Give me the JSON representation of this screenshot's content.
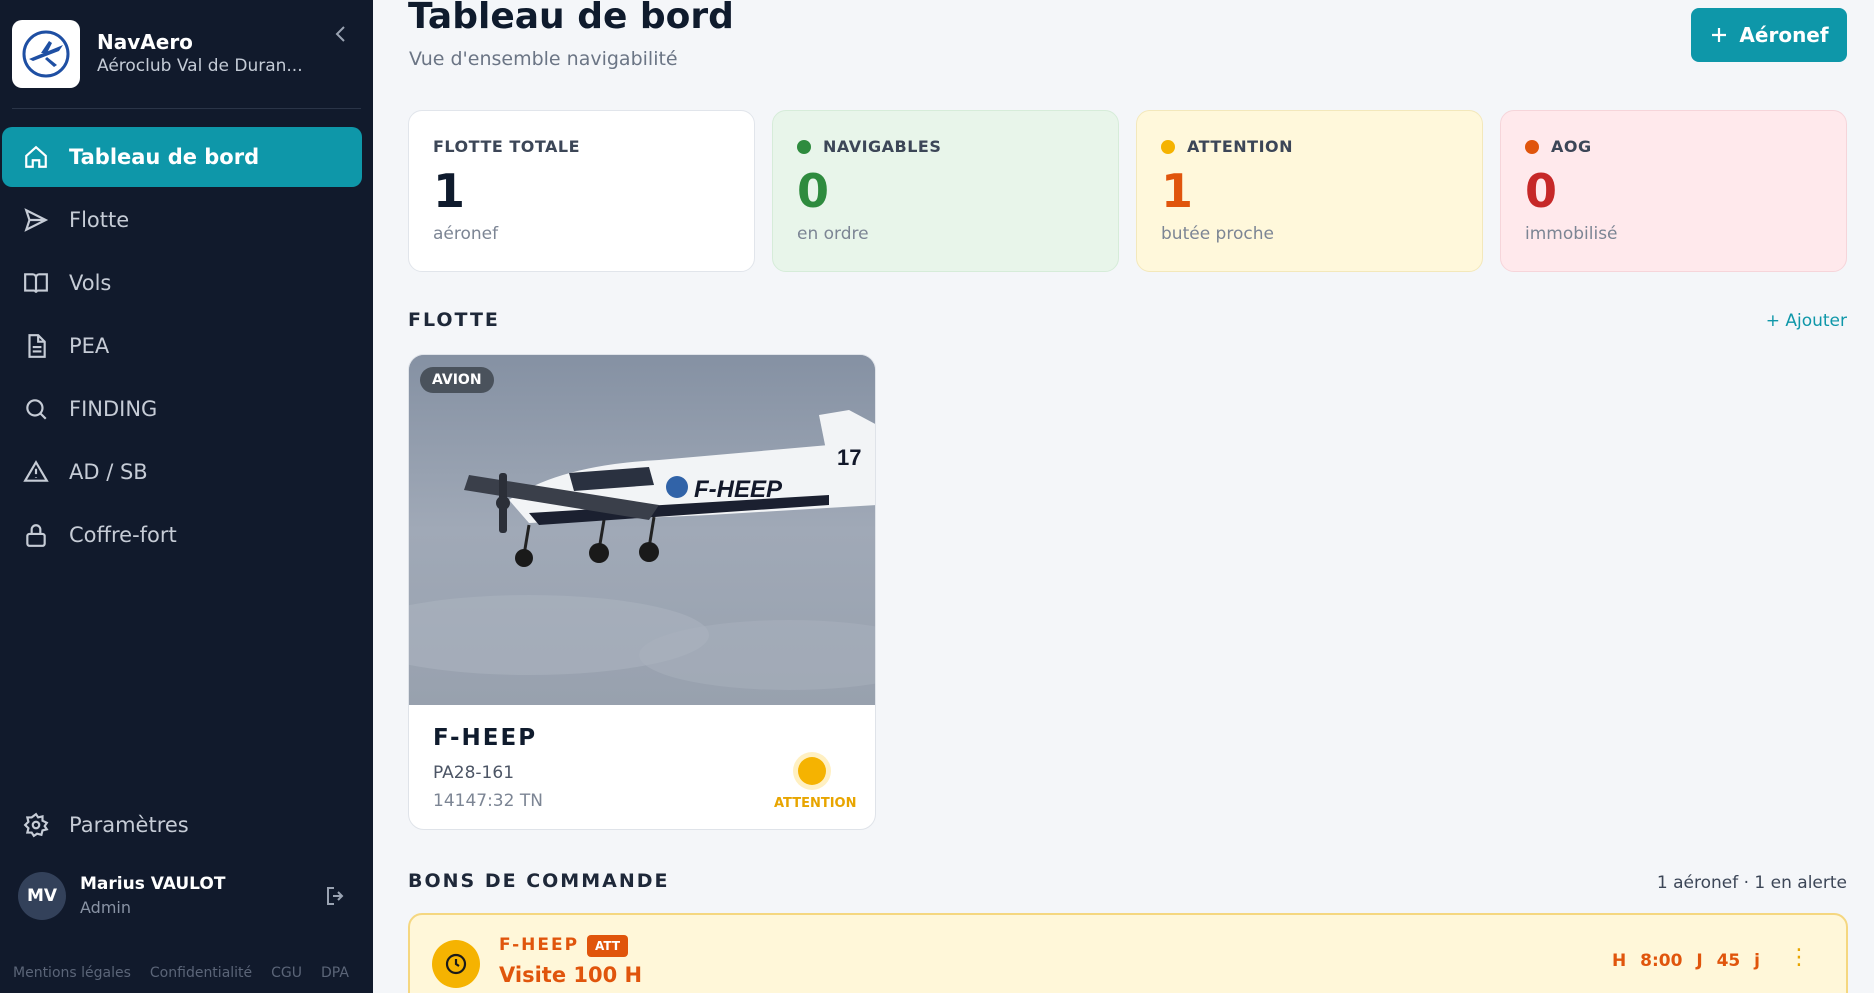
{
  "app": {
    "name": "NavAero",
    "club": "Aéroclub Val de Duran..."
  },
  "nav": [
    {
      "label": "Tableau de bord",
      "icon": "home-icon",
      "active": true
    },
    {
      "label": "Flotte",
      "icon": "send-icon"
    },
    {
      "label": "Vols",
      "icon": "book-icon"
    },
    {
      "label": "PEA",
      "icon": "document-icon"
    },
    {
      "label": "FINDING",
      "icon": "search-icon"
    },
    {
      "label": "AD / SB",
      "icon": "warning-icon"
    },
    {
      "label": "Coffre-fort",
      "icon": "lock-icon"
    }
  ],
  "params_label": "Paramètres",
  "user": {
    "initials": "MV",
    "name": "Marius VAULOT",
    "role": "Admin"
  },
  "footer": [
    "Mentions légales",
    "Confidentialité",
    "CGU",
    "DPA"
  ],
  "header": {
    "title": "Tableau de bord",
    "subtitle": "Vue d'ensemble navigabilité",
    "add_button": "Aéronef"
  },
  "stats": [
    {
      "label": "FLOTTE TOTALE",
      "value": "1",
      "caption": "aéronef",
      "bg": "#ffffff",
      "color": "#0f1b2d",
      "dot": null
    },
    {
      "label": "NAVIGABLES",
      "value": "0",
      "caption": "en ordre",
      "bg": "#e8f5ea",
      "color": "#2e8b3e",
      "dot": "#2e8b3e"
    },
    {
      "label": "ATTENTION",
      "value": "1",
      "caption": "butée proche",
      "bg": "#fff8db",
      "color": "#e0550c",
      "dot": "#f5b301"
    },
    {
      "label": "AOG",
      "value": "0",
      "caption": "immobilisé",
      "bg": "#ffe9ec",
      "color": "#c62828",
      "dot": "#e0550c"
    }
  ],
  "fleet": {
    "title": "FLOTTE",
    "add_link": "+ Ajouter"
  },
  "aircraft": {
    "type_badge": "AVION",
    "registration": "F-HEEP",
    "model": "PA28-161",
    "hours": "14147:32 TN",
    "status": "ATTENTION",
    "tail_number": "17"
  },
  "orders": {
    "title": "BONS DE COMMANDE",
    "summary": "1 aéronef · 1 en alerte",
    "items": [
      {
        "registration": "F-HEEP",
        "tag": "ATT",
        "title": "Visite 100 H",
        "meta": "H 8:00 J 45 j"
      }
    ]
  }
}
